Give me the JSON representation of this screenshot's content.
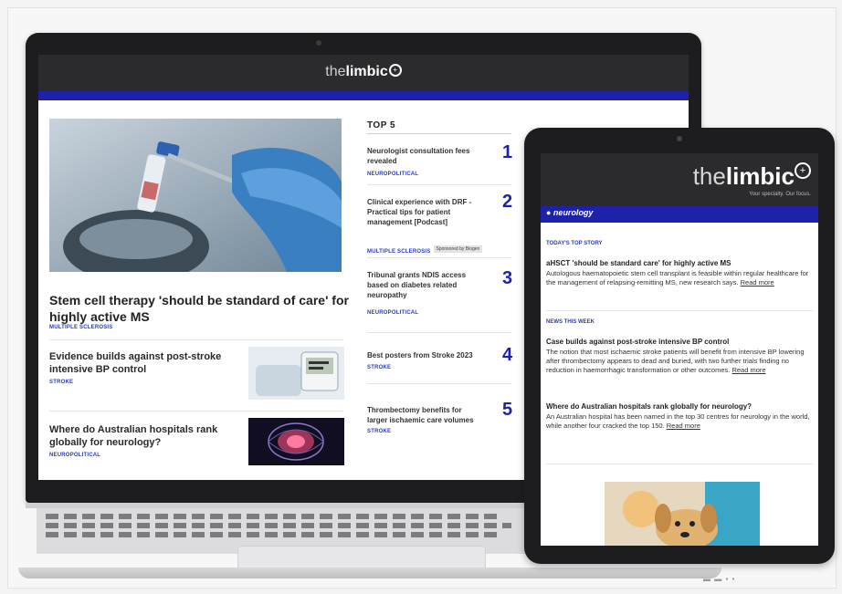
{
  "laptop": {
    "logo": {
      "light": "the",
      "bold": "limbic",
      "plus": "+"
    },
    "hero": {
      "title": "Stem cell therapy 'should be standard of care' for highly active MS",
      "tag": "MULTIPLE SCLEROSIS"
    },
    "stories": [
      {
        "title": "Evidence builds against post-stroke intensive BP control",
        "tag": "STROKE"
      },
      {
        "title": "Where do Australian hospitals rank globally for neurology?",
        "tag": "NEUROPOLITICAL"
      }
    ],
    "top5": {
      "heading": "TOP 5",
      "items": [
        {
          "title": "Neurologist consultation fees revealed",
          "number": "1",
          "tag": "NEUROPOLITICAL",
          "sponsor": ""
        },
        {
          "title": "Clinical experience with DRF - Practical tips for patient management [Podcast]",
          "number": "2",
          "tag": "MULTIPLE SCLEROSIS",
          "sponsor": "Sponsored by Biogen"
        },
        {
          "title": "Tribunal grants NDIS access based on diabetes related neuropathy",
          "number": "3",
          "tag": "NEUROPOLITICAL",
          "sponsor": ""
        },
        {
          "title": "Best posters from Stroke 2023",
          "number": "4",
          "tag": "STROKE",
          "sponsor": ""
        },
        {
          "title": "Thrombectomy benefits for larger ischaemic care volumes",
          "number": "5",
          "tag": "STROKE",
          "sponsor": ""
        }
      ]
    }
  },
  "tablet": {
    "logo": {
      "light": "the",
      "bold": "limbic",
      "plus": "+"
    },
    "tagline": "Your specialty. Our focus.",
    "section": "● neurology",
    "todays_top_story_label": "TODAY'S TOP STORY",
    "top_story": {
      "headline": "aHSCT 'should be standard care' for highly active MS",
      "body": "Autologous haematopoietic stem cell transplant is feasible within regular healthcare for the management of relapsing-remitting MS, new research says.",
      "read_more": "Read more"
    },
    "news_label": "NEWS THIS WEEK",
    "news": [
      {
        "headline": "Case builds against post-stroke intensive BP control",
        "body": "The notion that most ischaemic stroke patients will benefit from intensive BP lowering after thrombectomy appears to dead and buried, with two further trials finding no reduction in haemorrhagic transformation or other outcomes.",
        "read_more": "Read more"
      },
      {
        "headline": "Where do Australian hospitals rank globally for neurology?",
        "body": "An Australian hospital has been named in the top 30 centres for neurology in the world, while another four cracked the top 150.",
        "read_more": "Read more"
      }
    ]
  },
  "colors": {
    "brand_blue": "#1e22aa",
    "header_dark": "#2b2b2d"
  }
}
